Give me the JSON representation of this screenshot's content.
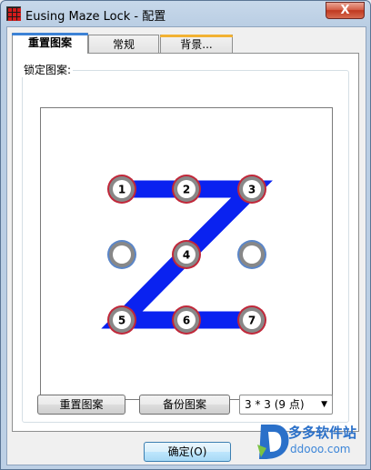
{
  "window": {
    "title": "Eusing Maze Lock - 配置",
    "close_glyph": "X"
  },
  "tabs": [
    {
      "label": "重置图案",
      "active": true
    },
    {
      "label": "常规",
      "active": false
    },
    {
      "label": "背景...",
      "active": false
    }
  ],
  "group": {
    "label": "锁定图案:"
  },
  "pattern": {
    "grid": "3x3",
    "dots": [
      {
        "label": "1",
        "selected": true
      },
      {
        "label": "2",
        "selected": true
      },
      {
        "label": "3",
        "selected": true
      },
      {
        "label": "",
        "selected": false
      },
      {
        "label": "4",
        "selected": true
      },
      {
        "label": "",
        "selected": false
      },
      {
        "label": "5",
        "selected": true
      },
      {
        "label": "6",
        "selected": true
      },
      {
        "label": "7",
        "selected": true
      }
    ],
    "path_order": [
      0,
      1,
      2,
      4,
      6,
      7,
      8
    ],
    "colors": {
      "line": "#0a22f0",
      "selected_ring": "#c0283a",
      "unselected_ring": "#5b86c8",
      "dot_fill": "#ffffff",
      "dot_inner_ring": "#888888"
    }
  },
  "buttons": {
    "reset": "重置图案",
    "backup": "备份图案",
    "ok": "确定(O)"
  },
  "grid_select": {
    "value": "3 * 3 (9 点)",
    "arrow": "▼"
  },
  "watermark": {
    "name": "多多软件站",
    "url": "ddooo.com",
    "color": "#2a70c9"
  }
}
